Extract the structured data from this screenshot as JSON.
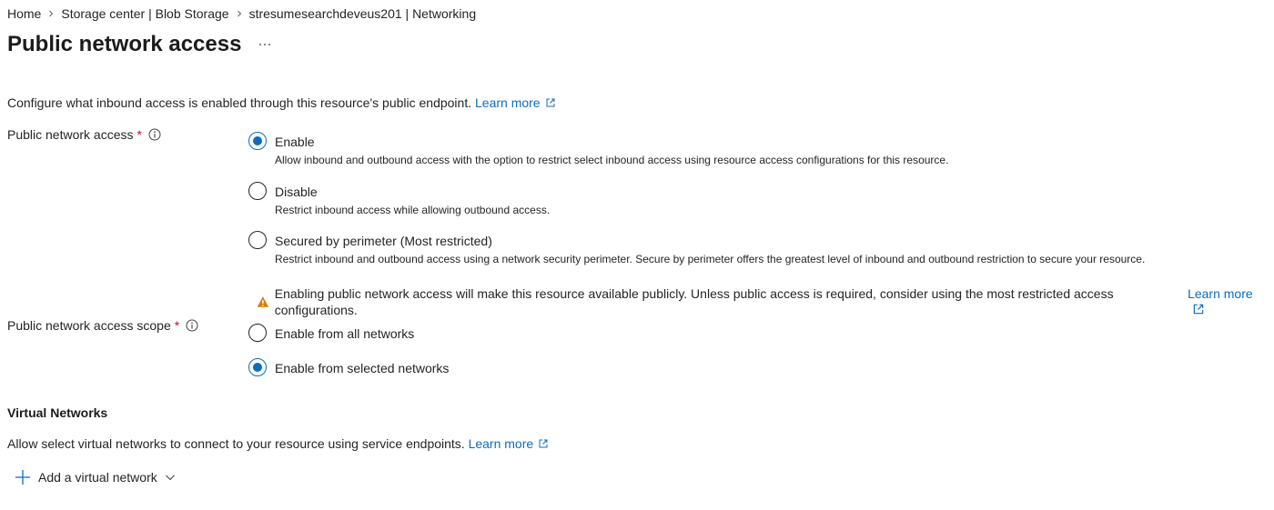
{
  "breadcrumb": {
    "items": [
      "Home",
      "Storage center | Blob Storage",
      "stresumesearchdeveus201 | Networking"
    ]
  },
  "page": {
    "title": "Public network access",
    "more_label": "···"
  },
  "description": {
    "text": "Configure what inbound access is enabled through this resource's public endpoint.",
    "learn_more": "Learn more"
  },
  "public_network_access": {
    "label": "Public network access",
    "required": "*",
    "selected": "Enable",
    "options": [
      {
        "label": "Enable",
        "description": "Allow inbound and outbound access with the option to restrict select inbound access using resource access configurations for this resource.",
        "checked": true
      },
      {
        "label": "Disable",
        "description": "Restrict inbound access while allowing outbound access.",
        "checked": false
      },
      {
        "label": "Secured by perimeter (Most restricted)",
        "description": "Restrict inbound and outbound access using a network security perimeter. Secure by perimeter offers the greatest level of inbound and outbound restriction to secure your resource.",
        "checked": false
      }
    ],
    "warning": {
      "text": "Enabling public network access will make this resource available publicly. Unless public access is required, consider using the most restricted access configurations.",
      "learn_more": "Learn more",
      "color": "#da7b00"
    }
  },
  "public_network_access_scope": {
    "label": "Public network access scope",
    "required": "*",
    "selected": "Enable from selected networks",
    "options": [
      {
        "label": "Enable from all networks",
        "checked": false
      },
      {
        "label": "Enable from selected networks",
        "checked": true
      }
    ]
  },
  "virtual_networks": {
    "heading": "Virtual Networks",
    "description": "Allow select virtual networks to connect to your resource using service endpoints.",
    "learn_more": "Learn more",
    "add_button": "Add a virtual network"
  },
  "colors": {
    "accent": "#0f6cbd",
    "required": "#c50f1f",
    "warning": "#da7b00"
  }
}
